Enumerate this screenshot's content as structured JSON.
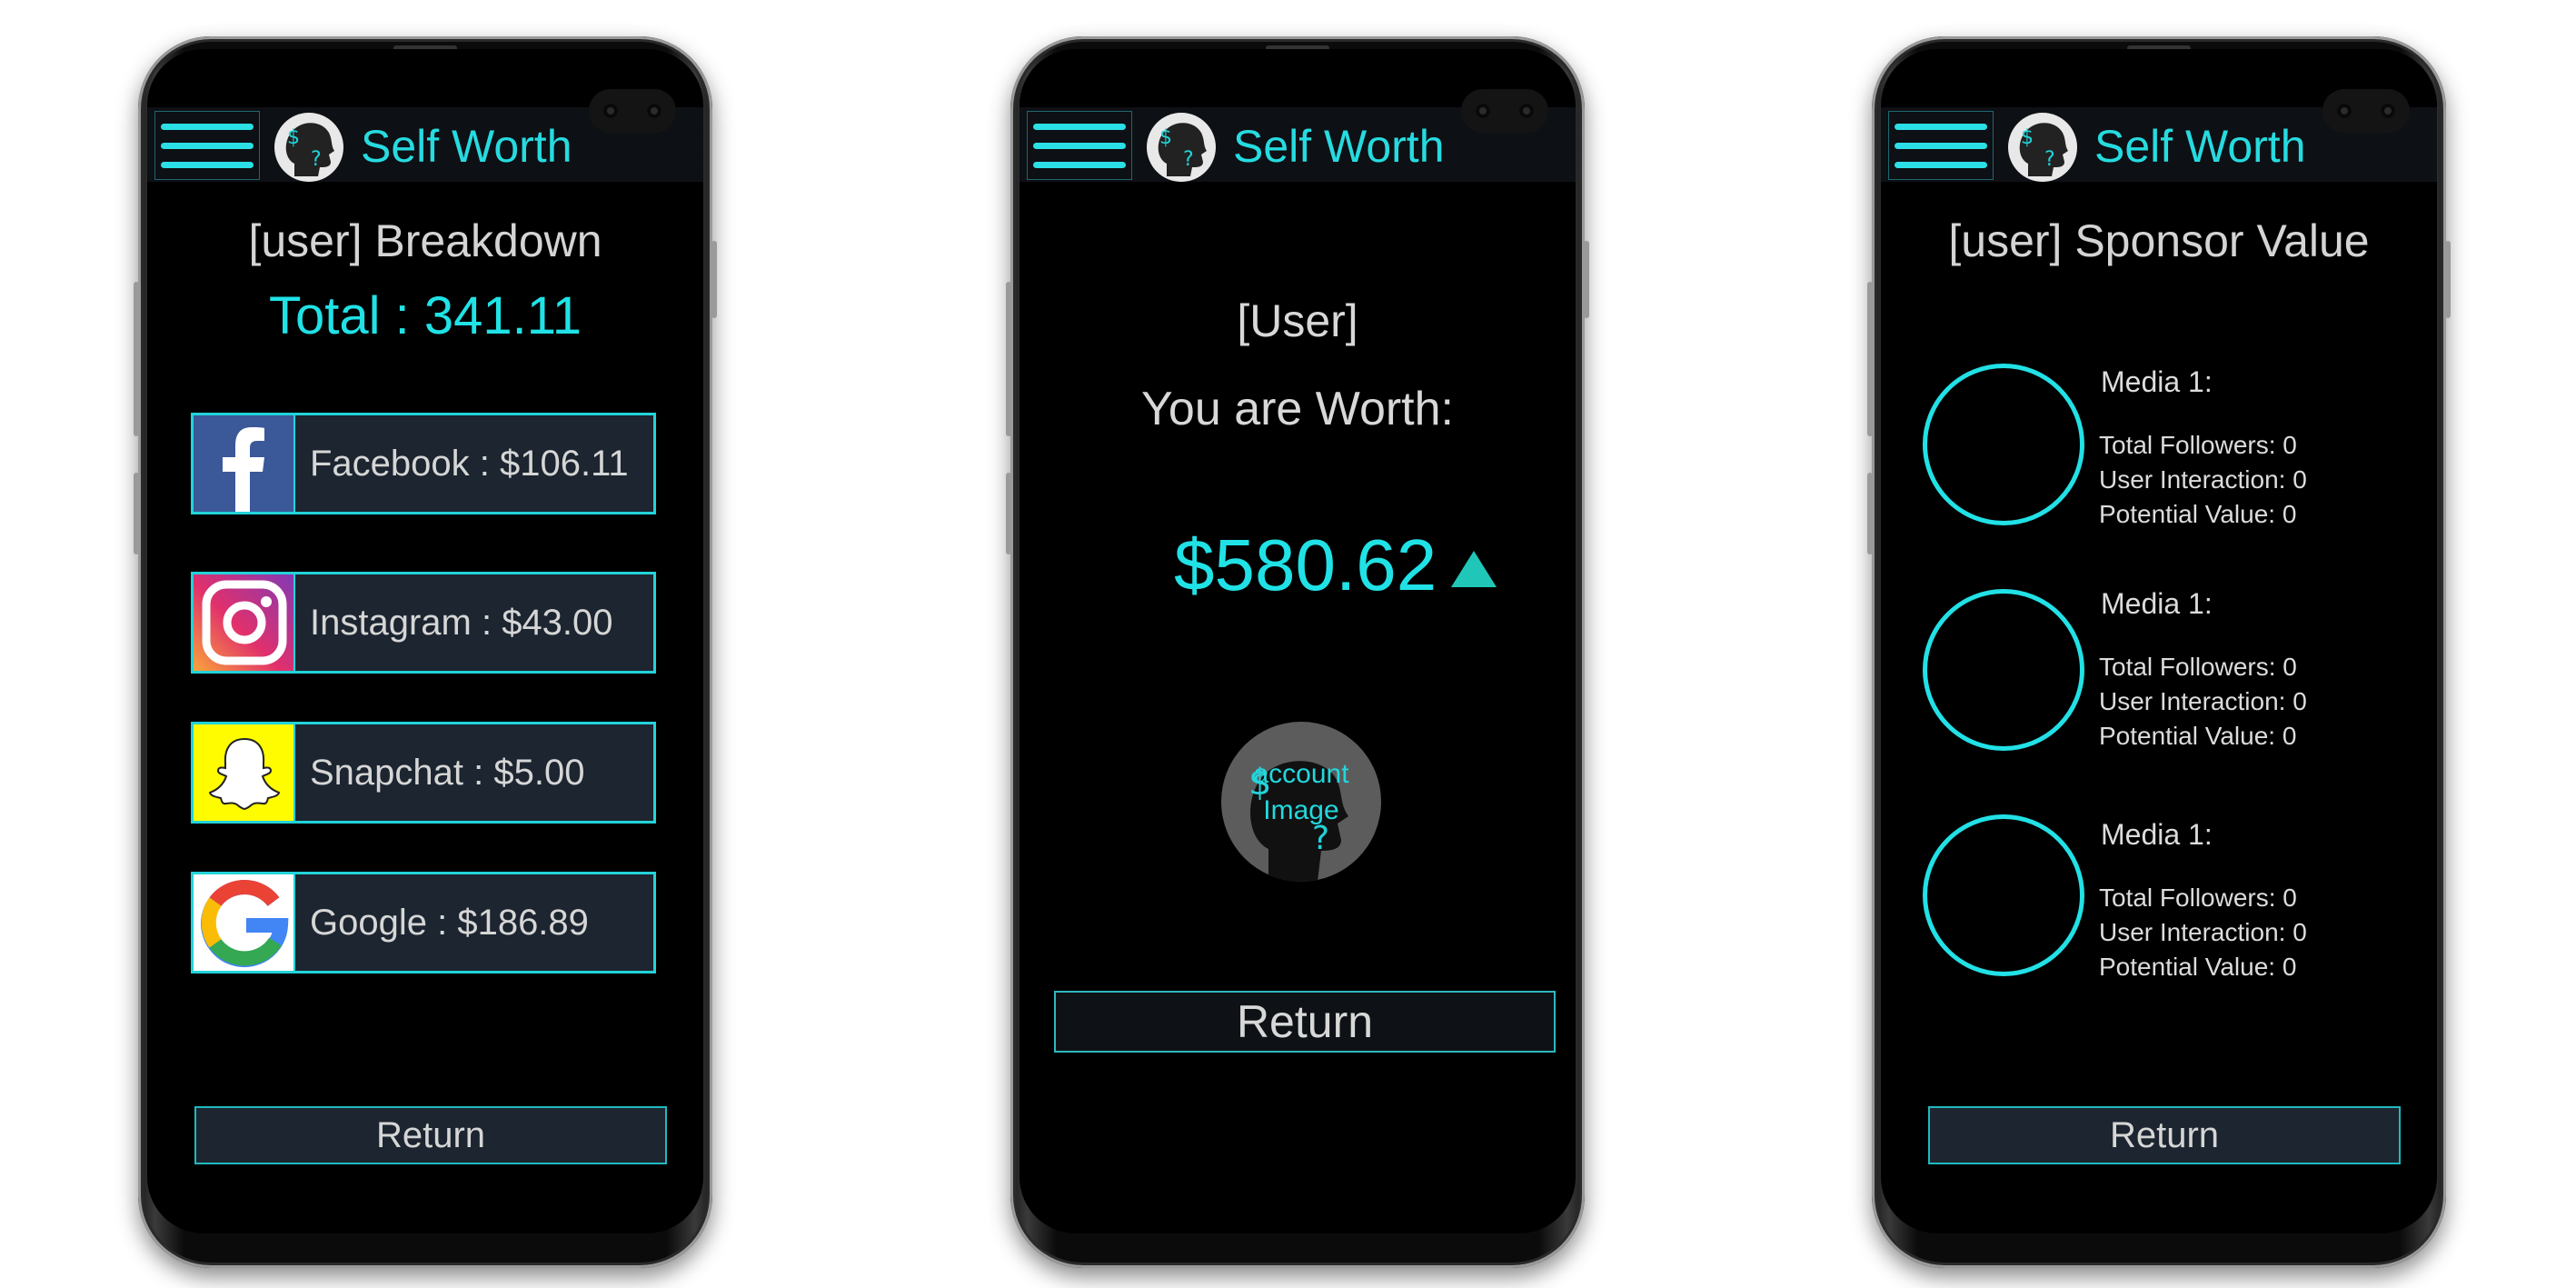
{
  "app": {
    "title": "Self Worth"
  },
  "colors": {
    "accent": "#22d3d9",
    "background": "#000000",
    "panel": "#1c2530"
  },
  "screens": {
    "breakdown": {
      "title": "[user] Breakdown",
      "total": "Total : 341.11",
      "socials": [
        {
          "icon": "facebook-icon",
          "label": "Facebook :  $106.11"
        },
        {
          "icon": "instagram-icon",
          "label": "Instagram : $43.00"
        },
        {
          "icon": "snapchat-icon",
          "label": "Snapchat : $5.00"
        },
        {
          "icon": "google-icon",
          "label": "Google : $186.89"
        }
      ],
      "return_label": "Return"
    },
    "worth": {
      "user": "[User]",
      "label": "You are Worth:",
      "value": "$580.62",
      "trend_icon": "up-arrow-icon",
      "account_image_label": "account Image",
      "return_label": "Return"
    },
    "sponsor": {
      "title": "[user] Sponsor Value",
      "media": [
        {
          "title": "Media 1:",
          "followers": "Total Followers: 0",
          "interaction": "User Interaction: 0",
          "potential": "Potential Value: 0"
        },
        {
          "title": "Media 1:",
          "followers": "Total Followers: 0",
          "interaction": "User Interaction: 0",
          "potential": "Potential Value: 0"
        },
        {
          "title": "Media 1:",
          "followers": "Total Followers: 0",
          "interaction": "User Interaction: 0",
          "potential": "Potential Value: 0"
        }
      ],
      "return_label": "Return"
    }
  }
}
